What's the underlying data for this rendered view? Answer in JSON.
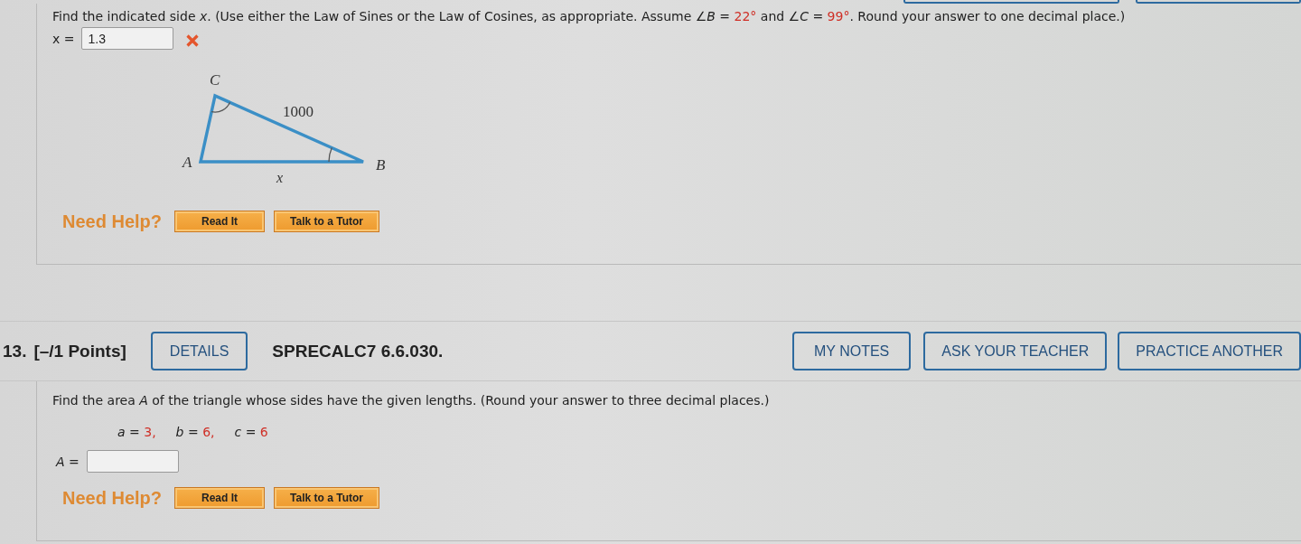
{
  "problem_12": {
    "question": [
      {
        "kind": "text",
        "text": "Find the indicated side *x*. (Use either the Law of Sines or the Law of Cosines, as appropriate. Assume ∠*B* = "
      },
      {
        "kind": "given",
        "text": "22°"
      },
      {
        "kind": "text",
        "text": " and ∠*C* = "
      },
      {
        "kind": "given",
        "text": "99°"
      },
      {
        "kind": "text",
        "text": ". Round your answer to one decimal place.)"
      }
    ],
    "answer": {
      "label": "x =",
      "value": "1.3",
      "correct": false
    },
    "figure": {
      "vertex_top": "C",
      "vertex_left": "A",
      "vertex_right": "B",
      "side_slanted": "1000",
      "side_bottom": "x"
    },
    "help": {
      "label": "Need Help?",
      "buttons": [
        "Read It",
        "Talk to a Tutor"
      ]
    }
  },
  "problem_13": {
    "number": "13.",
    "points": "[–/1 Points]",
    "details_button": "DETAILS",
    "code": "SPRECALC7 6.6.030.",
    "actions": [
      "MY NOTES",
      "ASK YOUR TEACHER",
      "PRACTICE ANOTHER"
    ],
    "question": "Find the area *A* of the triangle whose sides have the given lengths. (Round your answer to three decimal places.)",
    "givens": [
      [
        {
          "kind": "text",
          "text": "*a* = "
        },
        {
          "kind": "given",
          "text": "3,"
        }
      ],
      [
        {
          "kind": "text",
          "text": "*b* = "
        },
        {
          "kind": "given",
          "text": "6,"
        }
      ],
      [
        {
          "kind": "text",
          "text": "*c* = "
        },
        {
          "kind": "given",
          "text": "6"
        }
      ]
    ],
    "answer": {
      "label": "*A* ="
    },
    "help": {
      "label": "Need Help?",
      "buttons": [
        "Read It",
        "Talk to a Tutor"
      ]
    }
  }
}
